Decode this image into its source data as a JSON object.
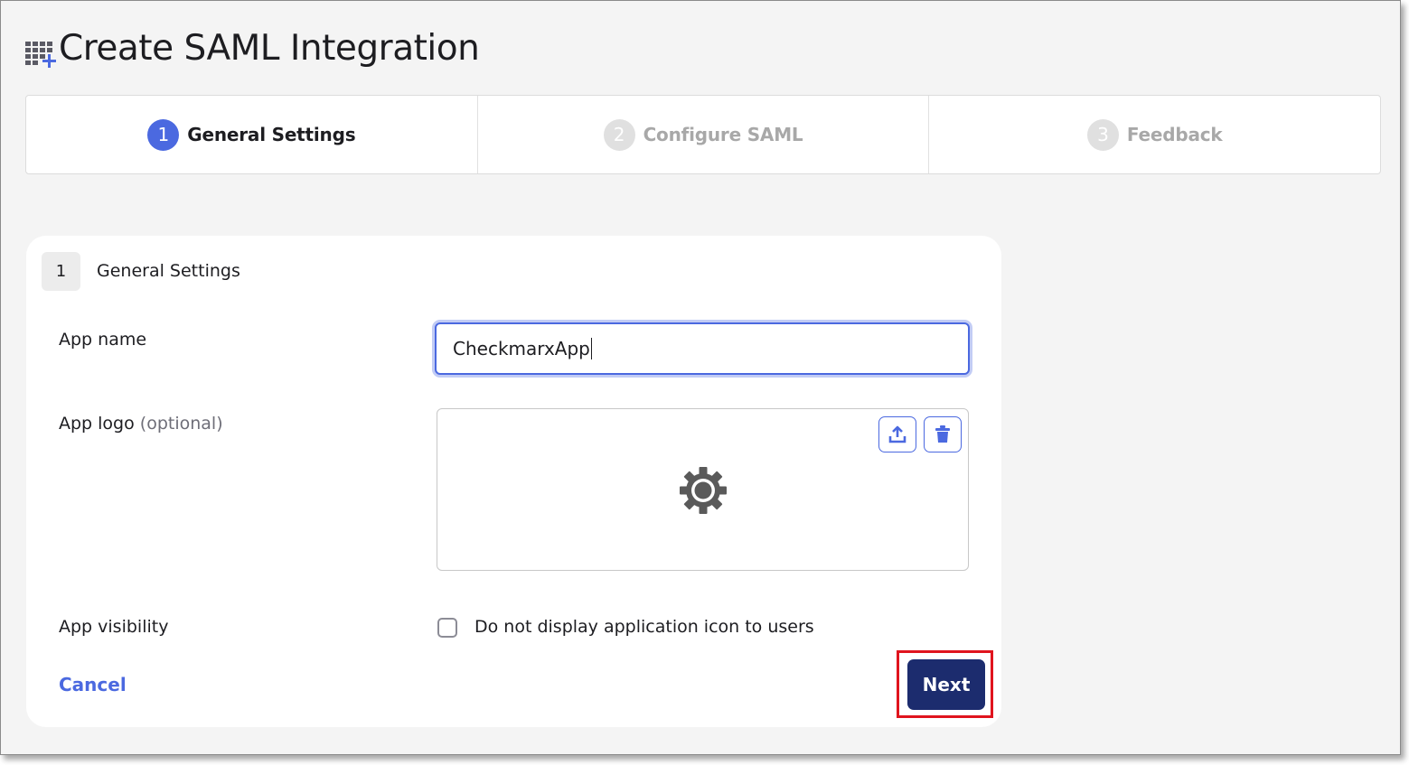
{
  "page": {
    "title": "Create SAML Integration"
  },
  "stepper": {
    "steps": [
      {
        "number": "1",
        "label": "General Settings",
        "state": "active"
      },
      {
        "number": "2",
        "label": "Configure SAML",
        "state": "inactive"
      },
      {
        "number": "3",
        "label": "Feedback",
        "state": "inactive"
      }
    ]
  },
  "section": {
    "number": "1",
    "title": "General Settings"
  },
  "form": {
    "app_name": {
      "label": "App name",
      "value": "CheckmarxApp"
    },
    "app_logo": {
      "label": "App logo",
      "optional": "(optional)",
      "icons": {
        "upload": "upload-icon",
        "delete": "trash-icon",
        "placeholder": "gear-icon"
      }
    },
    "app_visibility": {
      "label": "App visibility",
      "checkbox_label": "Do not display application icon to users",
      "checked": false
    }
  },
  "actions": {
    "cancel_label": "Cancel",
    "next_label": "Next"
  },
  "colors": {
    "accent": "#4b69e0",
    "primary_button": "#1c2c6e",
    "highlight_box": "#e0141e",
    "page_background": "#f4f4f4"
  }
}
